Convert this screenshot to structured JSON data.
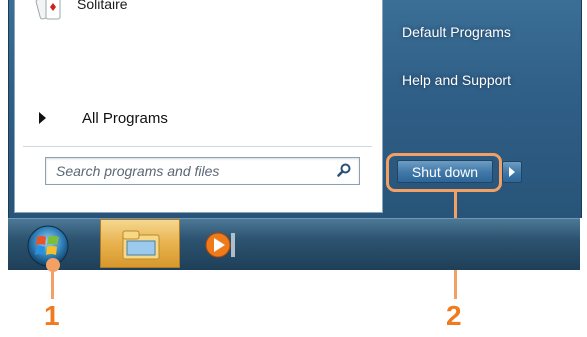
{
  "start_menu": {
    "programs": [
      {
        "label": "Solitaire",
        "icon": "solitaire-icon"
      }
    ],
    "all_programs_label": "All Programs",
    "search": {
      "placeholder": "Search programs and files"
    },
    "right_links": [
      "Default Programs",
      "Help and Support"
    ],
    "shutdown_label": "Shut down"
  },
  "callouts": [
    "1",
    "2"
  ],
  "colors": {
    "highlight": "#f2a063",
    "callout_text": "#f07a1e"
  }
}
